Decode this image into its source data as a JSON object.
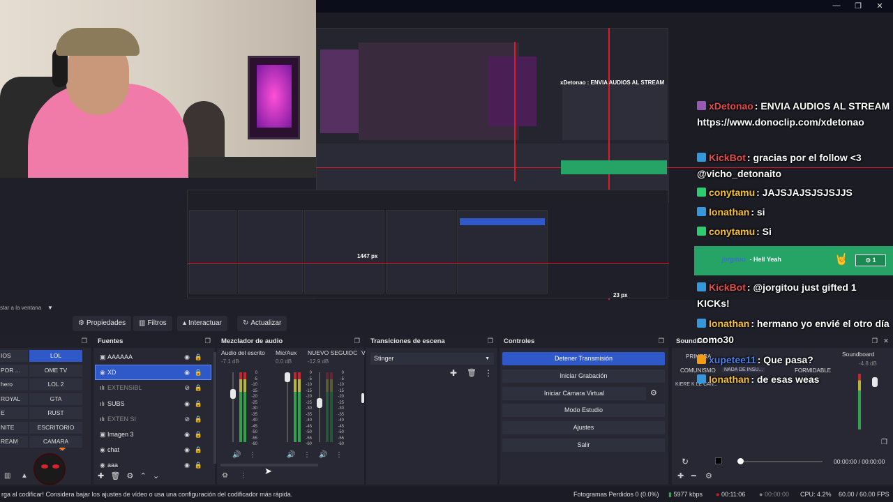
{
  "window": {
    "minimize": "—",
    "maximize": "❐",
    "close": "✕"
  },
  "toolbar": {
    "hint": "star a la ventana",
    "properties": "Propiedades",
    "filters": "Filtros",
    "interact": "Interactuar",
    "refresh": "Actualizar"
  },
  "scenes": {
    "left_col": [
      "IOS",
      "POR ...",
      "hero",
      "ROYAL",
      "E",
      "NITE",
      "REAM"
    ],
    "right_col": [
      "LOL",
      "OME TV",
      "LOL 2",
      "GTA",
      "RUST",
      "ESCRITORIO",
      "CAMARA"
    ],
    "active": "LOL"
  },
  "sources": {
    "title": "Fuentes",
    "items": [
      {
        "label": "AAAAAA",
        "icon": "▣"
      },
      {
        "label": "XD",
        "icon": "◉"
      },
      {
        "label": "EXTENSIBL",
        "icon": "ılı"
      },
      {
        "label": "SUBS",
        "icon": "ılı"
      },
      {
        "label": "EXTEN SI",
        "icon": "ılı"
      },
      {
        "label": "Imagen 3",
        "icon": "▣"
      },
      {
        "label": "chat",
        "icon": "◉"
      },
      {
        "label": "aaa",
        "icon": "◉"
      }
    ]
  },
  "mixer": {
    "title": "Mezclador de audio",
    "channels": [
      {
        "name": "Audio del escrito",
        "db": "-7.1 dB"
      },
      {
        "name": "Mic/Aux",
        "db": "0.0 dB"
      },
      {
        "name": "NUEVO SEGUIDC",
        "db": "-12.9 dB"
      },
      {
        "name": "V",
        "db": ""
      }
    ],
    "scale": [
      "0",
      "-5",
      "-10",
      "-15",
      "-20",
      "-25",
      "-30",
      "-35",
      "-40",
      "-45",
      "-50",
      "-55",
      "-60"
    ]
  },
  "transitions": {
    "title": "Transiciones de escena",
    "selected": "Stinger"
  },
  "controls": {
    "title": "Controles",
    "buttons": [
      "Detener Transmisión",
      "Iniciar Grabación",
      "Iniciar Cámara Virtual",
      "Modo Estudio",
      "Ajustes",
      "Salir"
    ]
  },
  "soundboard": {
    "title": "Soundbo",
    "items": [
      "PRIMERA",
      "COMUNISMO",
      "NADA DE INSU...",
      "FORMIDABLE",
      "KIERE K LE CAN..."
    ],
    "side_label": "Soundboard",
    "side_db": "-4.8 dB",
    "time_a": "00:00:00",
    "time_sep": "/",
    "time_b": "00:00:00"
  },
  "chat": [
    {
      "user": "xDetonao",
      "color": "#e54b4b",
      "text": ": ENVIA AUDIOS AL STREAM https://www.donoclip.com/xdetonao"
    },
    {
      "user": "KickBot",
      "color": "#e54b4b",
      "text": ": gracias por el follow <3 @vicho_detonaito"
    },
    {
      "user": "conytamu",
      "color": "#f6c12e",
      "text": ": JAJSJAJSJSJSJJS"
    },
    {
      "user": "Ionathan",
      "color": "#f6c12e",
      "text": ": si"
    },
    {
      "user": "conytamu",
      "color": "#f6c12e",
      "text": ": Si"
    },
    {
      "user": "KickBot",
      "color": "#e54b4b",
      "text": ": @jorgitou just gifted 1 KICKs!"
    },
    {
      "user": "Ionathan",
      "color": "#f6c12e",
      "text": ": hermano yo envié el otro día como30"
    },
    {
      "user": "xupetee11",
      "color": "#4b7fe5",
      "text": ": Que pasa?"
    },
    {
      "user": "Ionathan",
      "color": "#f6c12e",
      "text": ": de esas weas"
    }
  ],
  "donation": {
    "user": "jorgitou",
    "text": "- Hell Yeah",
    "amount": "1"
  },
  "overlay": {
    "mid_px": "1447 px",
    "small_px": "23 px"
  },
  "status": {
    "warning": "rga al codificar! Considera bajar los ajustes de vídeo o usa una configuración del codificador más rápida.",
    "dropped": "Fotogramas Perdidos 0 (0.0%)",
    "bitrate": "5977 kbps",
    "stream_time": "00:11:06",
    "rec_time": "00:00:00",
    "cpu": "CPU: 4.2%",
    "fps": "60.00 / 60.00 FPS"
  },
  "colors": {
    "accent": "#2f58c9",
    "live_red": "#e0192b",
    "donation_green": "#25a465"
  }
}
